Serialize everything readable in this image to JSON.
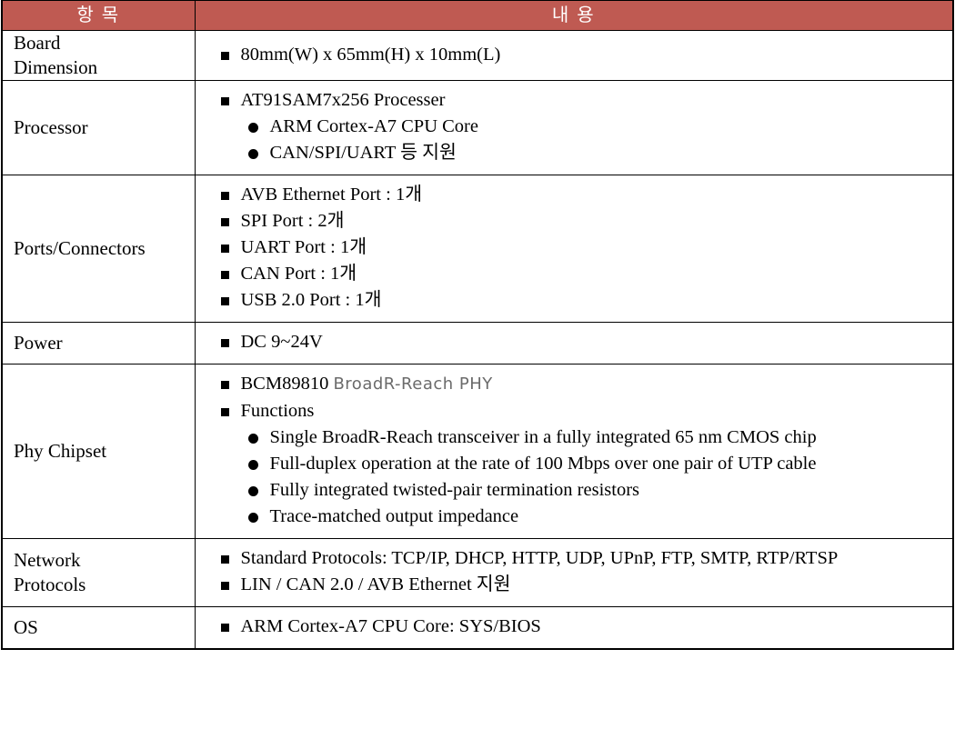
{
  "table": {
    "headers": {
      "item": "항 목",
      "content": "내 용"
    },
    "header_bg_color": "#BF5A52",
    "header_text_color": "#FFFFFF",
    "border_color": "#000000",
    "rows": [
      {
        "label": "Board\nDimension",
        "bullets": [
          {
            "level": 1,
            "text": "80mm(W) x 65mm(H) x 10mm(L)"
          }
        ]
      },
      {
        "label": "Processor",
        "bullets": [
          {
            "level": 1,
            "text": "AT91SAM7x256 Processer"
          },
          {
            "level": 2,
            "text": "ARM Cortex-A7 CPU Core"
          },
          {
            "level": 2,
            "text": "CAN/SPI/UART 등 지원"
          }
        ]
      },
      {
        "label": "Ports/Connectors",
        "bullets": [
          {
            "level": 1,
            "text": "AVB Ethernet Port : 1개"
          },
          {
            "level": 1,
            "text": "SPI Port : 2개"
          },
          {
            "level": 1,
            "text": "UART Port : 1개"
          },
          {
            "level": 1,
            "text": "CAN Port : 1개"
          },
          {
            "level": 1,
            "text": "USB 2.0 Port : 1개"
          }
        ]
      },
      {
        "label": "Power",
        "bullets": [
          {
            "level": 1,
            "text": "DC 9~24V"
          }
        ]
      },
      {
        "label": "Phy Chipset",
        "bullets": [
          {
            "level": 1,
            "text": "BCM89810",
            "suffix": "BroadR-Reach PHY"
          },
          {
            "level": 1,
            "text": "Functions"
          },
          {
            "level": 2,
            "text": "Single BroadR-Reach transceiver in a fully integrated 65 nm CMOS chip"
          },
          {
            "level": 2,
            "text": "Full-duplex operation at the rate of 100 Mbps over one pair of UTP cable"
          },
          {
            "level": 2,
            "text": "Fully integrated twisted-pair termination resistors"
          },
          {
            "level": 2,
            "text": "Trace-matched output impedance"
          }
        ]
      },
      {
        "label": "Network\nProtocols",
        "bullets": [
          {
            "level": 1,
            "text": "Standard Protocols: TCP/IP, DHCP, HTTP, UDP, UPnP, FTP, SMTP, RTP/RTSP"
          },
          {
            "level": 1,
            "text": "LIN / CAN 2.0 / AVB Ethernet 지원"
          }
        ]
      },
      {
        "label": "OS",
        "bullets": [
          {
            "level": 1,
            "text": "ARM Cortex-A7 CPU Core: SYS/BIOS"
          }
        ]
      }
    ]
  }
}
